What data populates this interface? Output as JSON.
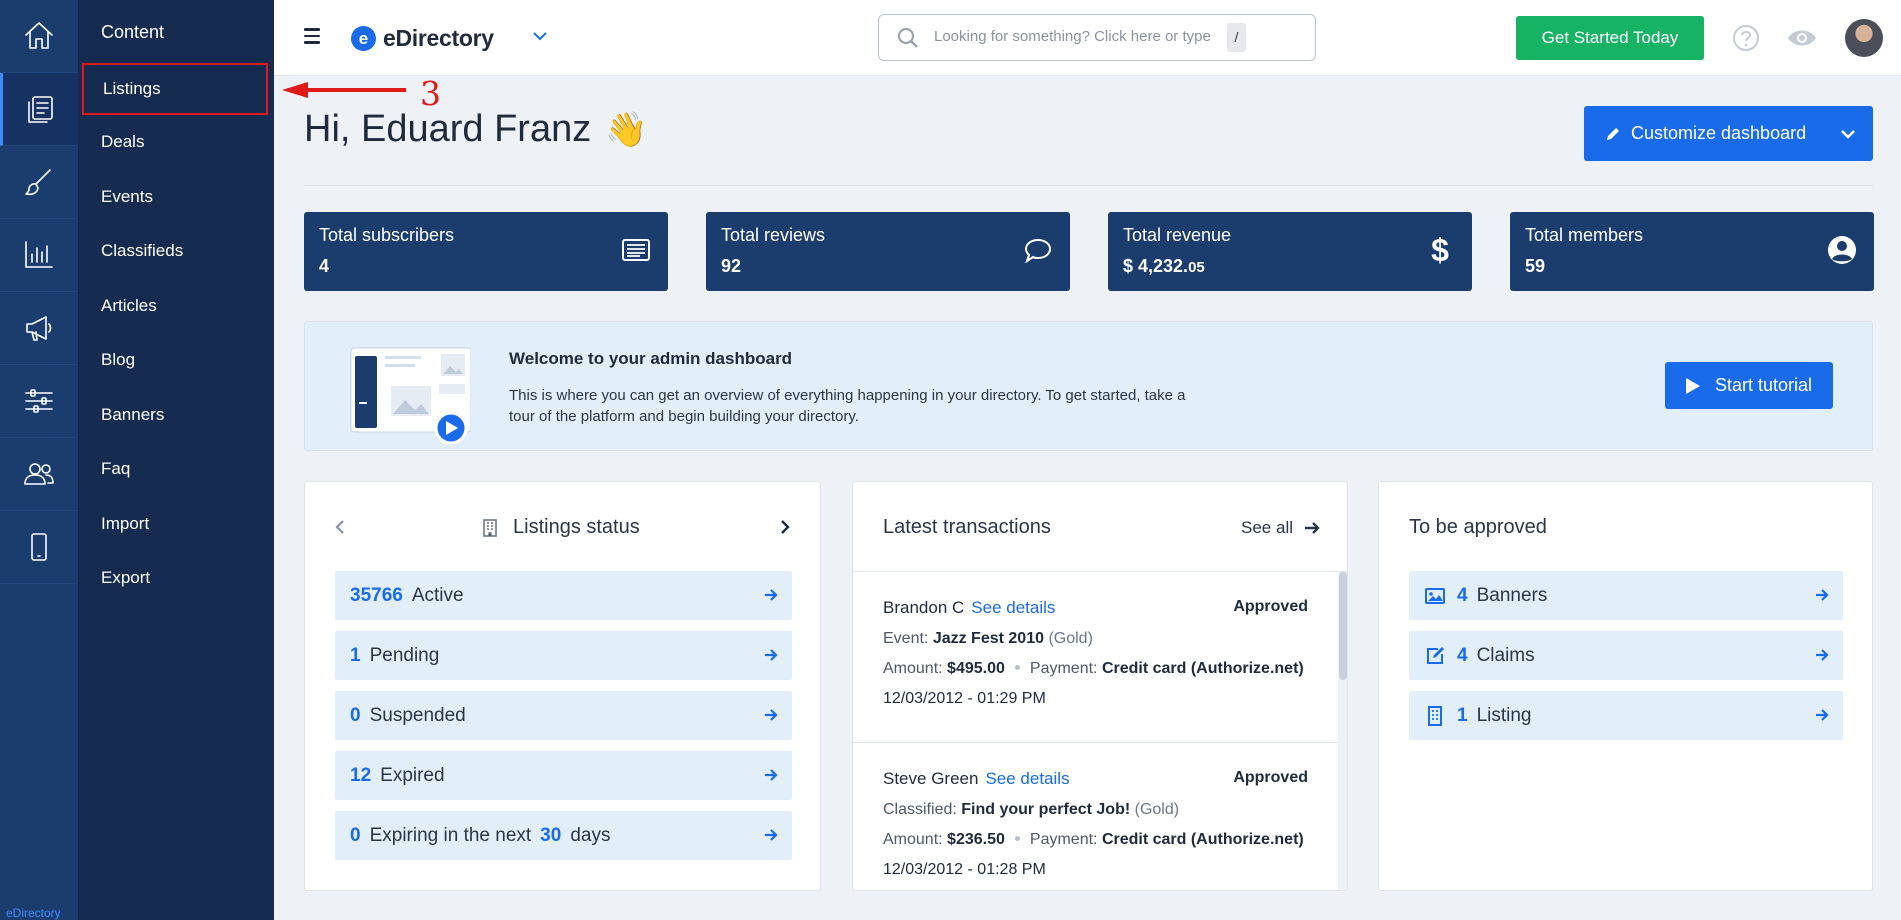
{
  "rail": {
    "items": [
      {
        "icon": "home-icon"
      },
      {
        "icon": "content-icon",
        "active": true
      },
      {
        "icon": "brush-icon"
      },
      {
        "icon": "chart-icon"
      },
      {
        "icon": "megaphone-icon"
      },
      {
        "icon": "sliders-icon"
      },
      {
        "icon": "users-icon"
      },
      {
        "icon": "mobile-icon"
      }
    ],
    "brand": "eDirectory"
  },
  "submenu": {
    "title": "Content",
    "items": [
      "Listings",
      "Deals",
      "Events",
      "Classifieds",
      "Articles",
      "Blog",
      "Banners",
      "Faq",
      "Import",
      "Export"
    ]
  },
  "annotation": {
    "number": "3",
    "color": "#e0191a"
  },
  "topbar": {
    "logo_letter": "e",
    "logo_text": "eDirectory",
    "search_placeholder": "Looking for something? Click here or type",
    "search_shortcut": "/",
    "cta_label": "Get Started Today"
  },
  "greeting": {
    "text": "Hi, Eduard Franz",
    "emoji": "👋"
  },
  "customize_label": "Customize dashboard",
  "stats": [
    {
      "label": "Total subscribers",
      "value": "4",
      "icon": "newsletter-icon"
    },
    {
      "label": "Total reviews",
      "value": "92",
      "icon": "comment-icon"
    },
    {
      "label": "Total revenue",
      "value": "$ 4,232.",
      "value_small": "05",
      "icon": "dollar-icon"
    },
    {
      "label": "Total members",
      "value": "59",
      "icon": "user-circle-icon"
    }
  ],
  "welcome": {
    "title": "Welcome to your admin dashboard",
    "text": "This is where you can get an overview of everything happening in your directory. To get started, take a tour of the platform and begin building your directory.",
    "button": "Start tutorial"
  },
  "listings_status": {
    "title": "Listings status",
    "rows": [
      {
        "count": "35766",
        "label": "Active"
      },
      {
        "count": "1",
        "label": "Pending"
      },
      {
        "count": "0",
        "label": "Suspended"
      },
      {
        "count": "12",
        "label": "Expired"
      },
      {
        "count": "0",
        "label": "Expiring in the next",
        "days": "30",
        "suffix": "days"
      }
    ]
  },
  "transactions": {
    "title": "Latest transactions",
    "see_all": "See all",
    "items": [
      {
        "name": "Brandon C",
        "details": "See details",
        "status": "Approved",
        "type_label": "Event:",
        "item": "Jazz Fest 2010",
        "level": "(Gold)",
        "amount_label": "Amount:",
        "amount": "$495.00",
        "payment_label": "Payment:",
        "payment": "Credit card (Authorize.net)",
        "date": "12/03/2012 - 01:29 PM"
      },
      {
        "name": "Steve Green",
        "details": "See details",
        "status": "Approved",
        "type_label": "Classified:",
        "item": "Find your perfect Job!",
        "level": "(Gold)",
        "amount_label": "Amount:",
        "amount": "$236.50",
        "payment_label": "Payment:",
        "payment": "Credit card (Authorize.net)",
        "date": "12/03/2012 - 01:28 PM"
      }
    ]
  },
  "approval": {
    "title": "To be approved",
    "rows": [
      {
        "count": "4",
        "label": "Banners",
        "icon": "image-icon"
      },
      {
        "count": "4",
        "label": "Claims",
        "icon": "edit-icon"
      },
      {
        "count": "1",
        "label": "Listing",
        "icon": "building-icon"
      }
    ]
  },
  "colors": {
    "primary": "#1a6bea",
    "navy": "#1a3d6d",
    "green": "#16b365",
    "annotation": "#e0191a"
  }
}
